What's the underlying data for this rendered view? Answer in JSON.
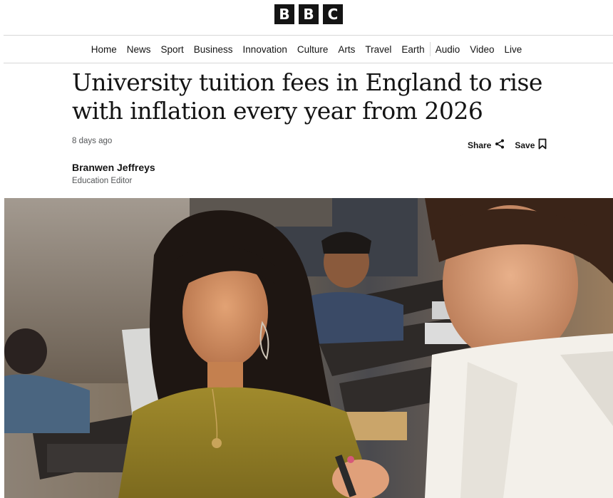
{
  "brand": {
    "logo_letters": [
      "B",
      "B",
      "C"
    ]
  },
  "nav": {
    "items": [
      "Home",
      "News",
      "Sport",
      "Business",
      "Innovation",
      "Culture",
      "Arts",
      "Travel",
      "Earth",
      "Audio",
      "Video",
      "Live"
    ]
  },
  "article": {
    "headline": "University tuition fees in England to rise with inflation every year from 2026",
    "timestamp": "8 days ago",
    "share_label": "Share",
    "save_label": "Save",
    "author_name": "Branwen Jeffreys",
    "author_role": "Education Editor"
  },
  "icons": {
    "share": "share-icon",
    "save": "bookmark-icon"
  },
  "colors": {
    "text": "#141414",
    "meta": "#545658",
    "logo_bg": "#141414"
  }
}
